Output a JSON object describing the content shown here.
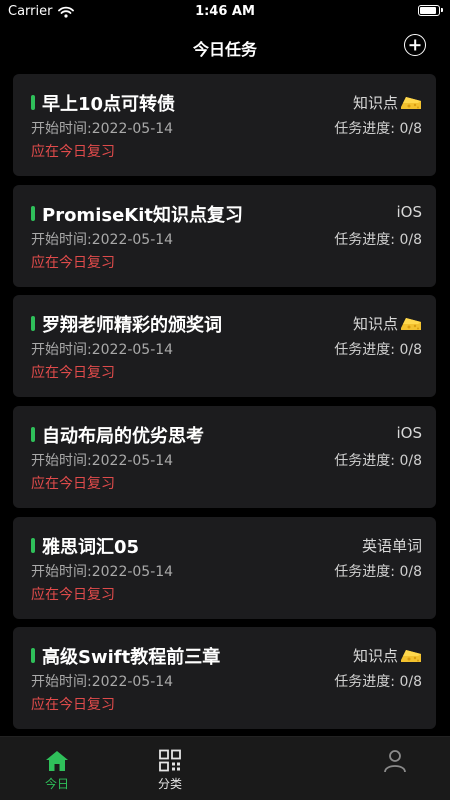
{
  "status_bar": {
    "carrier": "Carrier",
    "time": "1:46 AM",
    "battery_level": 0.95
  },
  "nav": {
    "title": "今日任务"
  },
  "tasks": [
    {
      "name": "早上10点可转债",
      "category": "知识点",
      "category_icon": "cheese-icon",
      "start": "开始时间:2022-05-14",
      "progress": "任务进度: 0/8",
      "review": "应在今日复习"
    },
    {
      "name": "PromiseKit知识点复习",
      "category": "iOS",
      "category_icon": "",
      "start": "开始时间:2022-05-14",
      "progress": "任务进度: 0/8",
      "review": "应在今日复习"
    },
    {
      "name": "罗翔老师精彩的颁奖词",
      "category": "知识点",
      "category_icon": "cheese-icon",
      "start": "开始时间:2022-05-14",
      "progress": "任务进度: 0/8",
      "review": "应在今日复习"
    },
    {
      "name": "自动布局的优劣思考",
      "category": "iOS",
      "category_icon": "",
      "start": "开始时间:2022-05-14",
      "progress": "任务进度: 0/8",
      "review": "应在今日复习"
    },
    {
      "name": "雅思词汇05",
      "category": "英语单词",
      "category_icon": "",
      "start": "开始时间:2022-05-14",
      "progress": "任务进度: 0/8",
      "review": "应在今日复习"
    },
    {
      "name": "高级Swift教程前三章",
      "category": "知识点",
      "category_icon": "cheese-icon",
      "start": "开始时间:2022-05-14",
      "progress": "任务进度: 0/8",
      "review": "应在今日复习"
    }
  ],
  "tabs": [
    {
      "label": "今日",
      "icon": "home-icon",
      "active": true
    },
    {
      "label": "分类",
      "icon": "grid-icon",
      "active": false
    }
  ],
  "colors": {
    "accent": "#2fc05a",
    "review": "#e04b4b",
    "card": "#1c1c1e",
    "background": "#000000"
  }
}
